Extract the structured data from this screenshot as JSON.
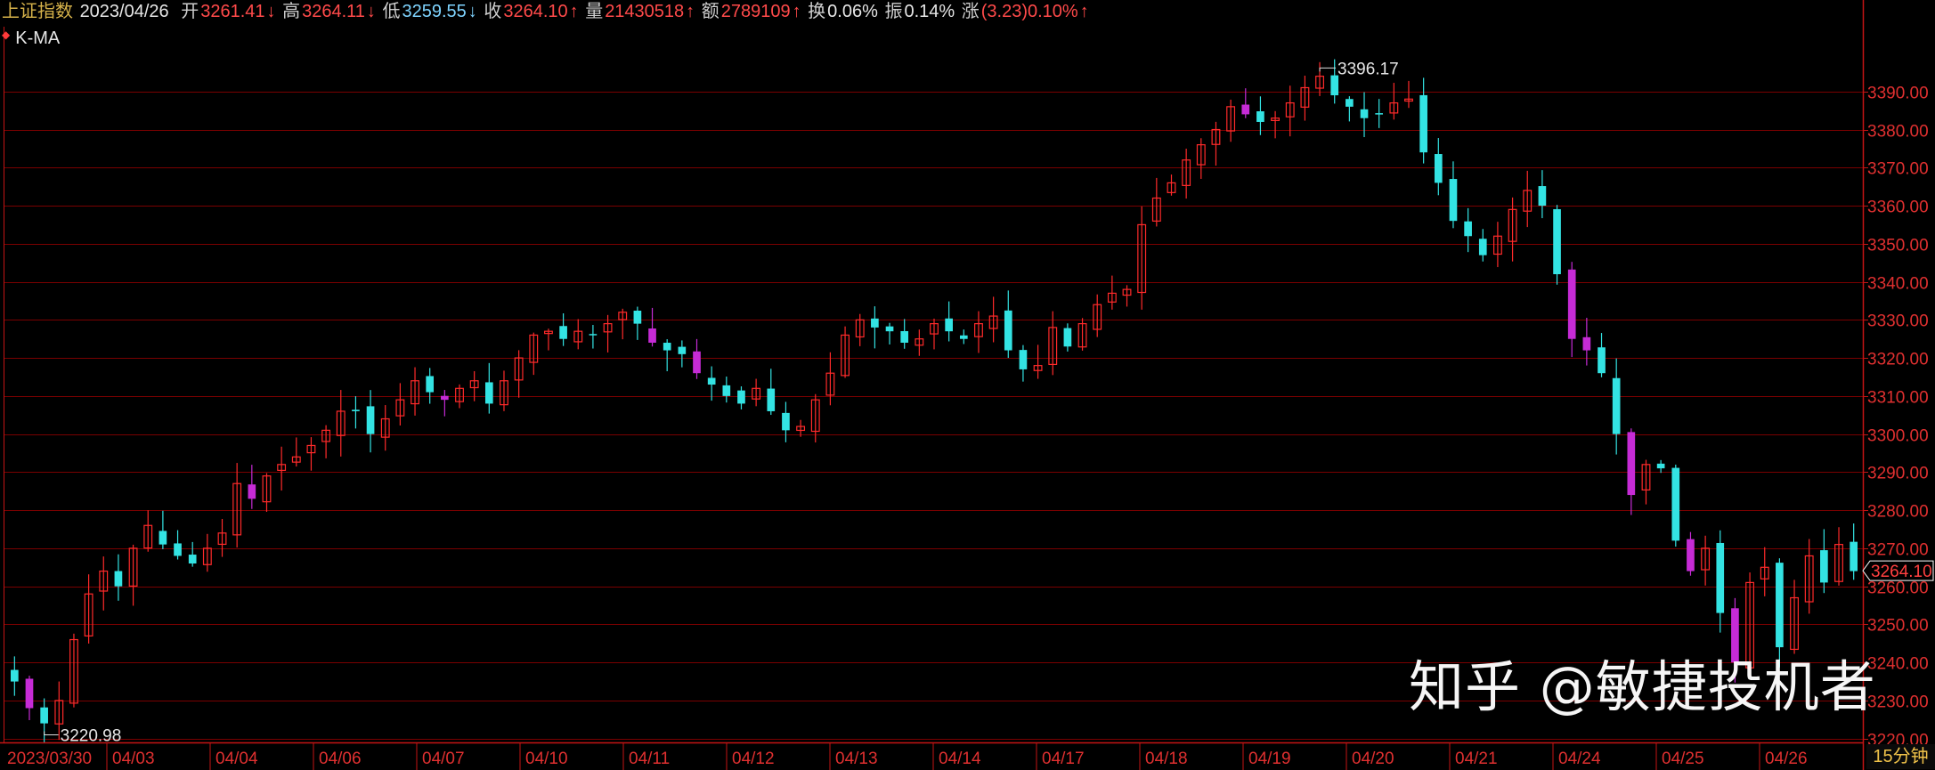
{
  "header": {
    "name": "上证指数",
    "date": "2023/04/26",
    "open_label": "开",
    "open": "3261.41",
    "high_label": "高",
    "high": "3264.11",
    "low_label": "低",
    "low": "3259.55",
    "close_label": "收",
    "close": "3264.10",
    "volume_label": "量",
    "volume": "21430518",
    "amount_label": "额",
    "amount": "2789109",
    "turnover_label": "换",
    "turnover": "0.06%",
    "amplitude_label": "振",
    "amplitude": "0.14%",
    "change_label": "涨",
    "change": "(3.23)0.10%",
    "up_arrow": "↑",
    "down_arrow": "↓"
  },
  "series_label": "K-MA",
  "watermark": "知乎 @敏捷投机者",
  "period": "15分钟",
  "colors": {
    "up": "#ff2a2a",
    "down": "#33e3e3",
    "magenta": "#c62bd6",
    "grid": "#7a0000",
    "axis": "#c41414",
    "background": "#000000"
  },
  "chart_data": {
    "type": "candlestick",
    "interval": "15分钟",
    "y_ticks": [
      3220.0,
      3230.0,
      3240.0,
      3250.0,
      3260.0,
      3270.0,
      3280.0,
      3290.0,
      3300.0,
      3310.0,
      3320.0,
      3330.0,
      3340.0,
      3350.0,
      3360.0,
      3370.0,
      3380.0,
      3390.0
    ],
    "ylim": [
      3219.0,
      3400.0
    ],
    "x_tick_labels": [
      "2023/03/30",
      "04/03",
      "04/04",
      "04/06",
      "04/07",
      "04/10",
      "04/11",
      "04/12",
      "04/13",
      "04/14",
      "04/17",
      "04/18",
      "04/19",
      "04/20",
      "04/21",
      "04/24",
      "04/25",
      "04/26"
    ],
    "last_price": "3264.10",
    "max_annotation": {
      "value": "3396.17"
    },
    "min_annotation": {
      "value": "3220.98"
    },
    "trend_closes": [
      3235,
      3228,
      3224,
      3230,
      3246,
      3258,
      3264,
      3260,
      3270,
      3276,
      3271,
      3268,
      3266,
      3270,
      3274,
      3287,
      3283,
      3289,
      3292,
      3294,
      3297,
      3301,
      3306,
      3306,
      3300,
      3304,
      3309,
      3314,
      3311,
      3309,
      3312,
      3314,
      3308,
      3314,
      3320,
      3326,
      3327,
      3325,
      3327,
      3326,
      3329,
      3332,
      3329,
      3324,
      3322,
      3321,
      3316,
      3313,
      3310,
      3308,
      3312,
      3306,
      3301,
      3302,
      3309,
      3316,
      3326,
      3330,
      3328,
      3327,
      3324,
      3325,
      3329,
      3327,
      3325,
      3329,
      3331,
      3322,
      3317,
      3318,
      3328,
      3323,
      3329,
      3334,
      3337,
      3338,
      3355,
      3362,
      3366,
      3372,
      3376,
      3380,
      3386,
      3384,
      3382,
      3383,
      3387,
      3391,
      3394,
      3389,
      3386,
      3383,
      3384,
      3387,
      3388,
      3374,
      3366,
      3356,
      3352,
      3347,
      3352,
      3359,
      3364,
      3360,
      3342,
      3325,
      3322,
      3316,
      3300,
      3284,
      3292,
      3291,
      3272,
      3264,
      3270,
      3253,
      3240,
      3261,
      3265,
      3244,
      3257,
      3268,
      3261,
      3271,
      3264
    ]
  }
}
